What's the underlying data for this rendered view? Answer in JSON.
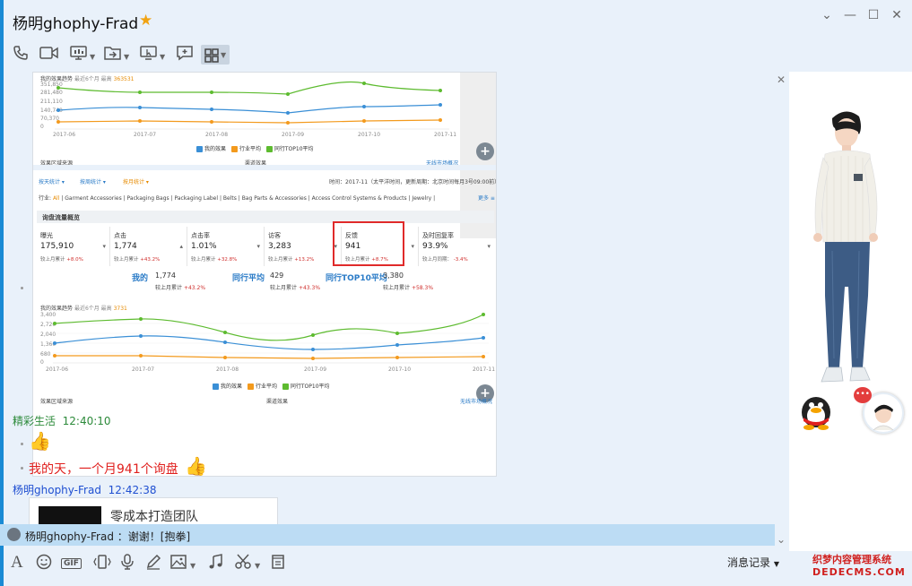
{
  "window": {
    "title": "杨明ghophy-Frad"
  },
  "embedded": {
    "top_panel": {
      "chart_title": "我的效果趋势",
      "chart_sub": "最近6个月 最高",
      "chart_max": "363531",
      "ticks_y": [
        "351,850",
        "281,480",
        "211,110",
        "140,740",
        "70,370",
        "0"
      ],
      "ticks_x": [
        "2017-06",
        "2017-07",
        "2017-08",
        "2017-09",
        "2017-10",
        "2017-11"
      ],
      "legend": [
        "我的效果",
        "行业平均",
        "同行TOP10平均"
      ],
      "footer_left": "效果区域来源",
      "footer_mid": "渠道效果",
      "footer_right": "无线市场概况"
    },
    "panel": {
      "tabs": [
        "按天统计",
        "按周统计",
        "按月统计"
      ],
      "time_label": "时间：2017-11（太平洋时间，更新周期：北京时间每月3号09:00前）",
      "industry_label": "行业:",
      "industries": [
        "All",
        "Garment Accessories",
        "Packaging Bags",
        "Packaging Label",
        "Belts",
        "Bag Parts & Accessories",
        "Access Control Systems & Products",
        "Jewelry"
      ],
      "more": "更多",
      "section_title": "询盘流量概览",
      "metrics": [
        {
          "name": "曝光",
          "value": "175,910",
          "cmp": "较上月累计",
          "delta": "+8.0%"
        },
        {
          "name": "点击",
          "value": "1,774",
          "cmp": "较上月累计",
          "delta": "+43.2%"
        },
        {
          "name": "点击率",
          "value": "1.01%",
          "cmp": "较上月累计",
          "delta": "+32.8%"
        },
        {
          "name": "访客",
          "value": "3,283",
          "cmp": "较上月累计",
          "delta": "+13.2%"
        },
        {
          "name": "反馈",
          "value": "941",
          "cmp": "较上月累计",
          "delta": "+8.7%"
        },
        {
          "name": "及时回复率",
          "value": "93.9%",
          "cmp": "较上月同期：",
          "delta": "-3.4%"
        }
      ],
      "compare": [
        {
          "label": "我的",
          "value": "1,774",
          "cmp": "较上月累计",
          "delta": "+43.2%"
        },
        {
          "label": "同行平均",
          "value": "429",
          "cmp": "较上月累计",
          "delta": "+43.3%"
        },
        {
          "label": "同行TOP10平均",
          "value": "3,380",
          "cmp": "较上月累计",
          "delta": "+58.3%"
        }
      ],
      "chart_title": "我的效果趋势",
      "chart_sub": "最近6个月 最高",
      "chart_max": "3731",
      "ticks_y": [
        "3,400",
        "2,720",
        "2,040",
        "1,360",
        "680",
        "0"
      ],
      "ticks_x": [
        "2017-06",
        "2017-07",
        "2017-08",
        "2017-09",
        "2017-10",
        "2017-11"
      ],
      "legend": [
        "我的效果",
        "行业平均",
        "同行TOP10平均"
      ],
      "footer_left": "效果区域来源",
      "footer_mid": "渠道效果",
      "footer_right": "无线市场概况"
    }
  },
  "messages": [
    {
      "sender": "精彩生活",
      "time": "12:40:10",
      "text": "我的天，一个月941个询盘"
    },
    {
      "sender": "杨明ghophy-Frad",
      "time": "12:42:38"
    }
  ],
  "card": {
    "title": "零成本打造团队"
  },
  "notice": {
    "text": "杨明ghophy-Frad ：谢谢！[抱拳]"
  },
  "input_toolbar": {
    "gif_label": "GIF",
    "history_label": "消息记录"
  },
  "watermark": {
    "line1": "织梦内容管理系统",
    "line2": "DEDECMS.COM"
  },
  "colors": {
    "accent": "#1a8ad4",
    "notice_bg": "#bcdcf4",
    "series_green": "#5dbb2f",
    "series_blue": "#3a8fd6",
    "series_orange": "#f39a1d",
    "highlight": "#e02a2a"
  }
}
